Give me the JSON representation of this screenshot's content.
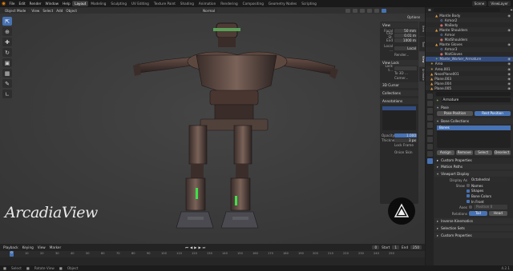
{
  "topbar": {
    "menus": [
      "File",
      "Edit",
      "Render",
      "Window",
      "Help"
    ],
    "workspaces": [
      "Layout",
      "Modeling",
      "Sculpting",
      "UV Editing",
      "Texture Paint",
      "Shading",
      "Animation",
      "Rendering",
      "Compositing",
      "Geometry Nodes",
      "Scripting"
    ],
    "active_workspace": "Layout",
    "scene": "Scene",
    "view_layer": "ViewLayer"
  },
  "viewport": {
    "mode": "Object Mode",
    "menus": [
      "View",
      "Select",
      "Add",
      "Object"
    ],
    "transform": "Normal",
    "options": "Options",
    "watermark": "ArcadiaView"
  },
  "npanel": {
    "view_title": "View",
    "rows": [
      {
        "k": "Focal",
        "v": "50 mm"
      },
      {
        "k": "Clip St.",
        "v": "0.01 m"
      },
      {
        "k": "End",
        "v": "1000 m"
      }
    ],
    "local": "Local ...",
    "local_val": "Local",
    "render": "Render...",
    "view_lock": "View Lock",
    "lock_to": "Lock t...",
    "to_3d": "To 3D ...",
    "camera": "Camer...",
    "cursor3d": "3D Cursor",
    "collections": "Collections",
    "annotations": "Annotations",
    "opacity_label": "Opacity",
    "opacity": "1.000",
    "thickness_label": "Thickness",
    "thickness": "3 px",
    "lock_frame": "Lock Frame",
    "onion": "Onion Skin",
    "tabs": [
      "Item",
      "Tool",
      "View",
      "Animate"
    ]
  },
  "outliner": {
    "rows": [
      {
        "name": "Mantle Body",
        "icon": "mesh",
        "depth": 2,
        "sel": false
      },
      {
        "name": "Armor2",
        "icon": "mod",
        "depth": 3,
        "sel": false
      },
      {
        "name": "MaBody",
        "icon": "mat",
        "depth": 3,
        "sel": false
      },
      {
        "name": "Mante Shoulders",
        "icon": "mesh",
        "depth": 2,
        "sel": false
      },
      {
        "name": "Armor",
        "icon": "mod",
        "depth": 3,
        "sel": false
      },
      {
        "name": "MatShoulders",
        "icon": "mat",
        "depth": 3,
        "sel": false
      },
      {
        "name": "Mante Gloves",
        "icon": "mesh",
        "depth": 2,
        "sel": false
      },
      {
        "name": "Armor3",
        "icon": "mod",
        "depth": 3,
        "sel": false
      },
      {
        "name": "MatGloves",
        "icon": "mat",
        "depth": 3,
        "sel": false
      },
      {
        "name": "Mante_Worker_Armature",
        "icon": "arm",
        "depth": 2,
        "sel": true
      },
      {
        "name": "Area",
        "icon": "light",
        "depth": 1,
        "sel": false
      },
      {
        "name": "Area.001",
        "icon": "light",
        "depth": 1,
        "sel": false
      },
      {
        "name": "NeonPlane001",
        "icon": "mesh",
        "depth": 1,
        "sel": false
      },
      {
        "name": "Plane.003",
        "icon": "mesh",
        "depth": 1,
        "sel": false
      },
      {
        "name": "Plane.004",
        "icon": "mesh",
        "depth": 1,
        "sel": false
      },
      {
        "name": "Plane.005",
        "icon": "mesh",
        "depth": 1,
        "sel": false
      }
    ]
  },
  "properties": {
    "object_name": "Armature",
    "pose_section": "Pose",
    "pose_position": "Pose Position",
    "rest_position": "Rest Position",
    "bone_collections": "Bone Collections",
    "collection_item": "Bones",
    "assign": "Assign",
    "remove": "Remove",
    "select": "Select",
    "deselect": "Deselect",
    "custom_props": "Custom Properties",
    "motion_paths": "Motion Paths",
    "viewport_display": "Viewport Display",
    "display_as_label": "Display As",
    "display_as": "Octahedral",
    "show_label": "Show",
    "show_items": [
      {
        "label": "Names",
        "on": false
      },
      {
        "label": "Shapes",
        "on": true
      },
      {
        "label": "Bone Colors",
        "on": true
      },
      {
        "label": "In Front",
        "on": true
      }
    ],
    "axes_label": "Axes",
    "position_label": "Position",
    "position": "0",
    "relations_label": "Relations",
    "tail": "Tail",
    "head": "Head",
    "inverse_kin": "Inverse Kinematics",
    "selection_sets": "Selection Sets",
    "custom_props2": "Custom Properties"
  },
  "timeline": {
    "menus": [
      "Playback",
      "Keying",
      "View",
      "Marker"
    ],
    "current": "0",
    "start_label": "Start",
    "start": "1",
    "end_label": "End",
    "end": "250",
    "ticks": [
      "0",
      "10",
      "20",
      "30",
      "40",
      "50",
      "60",
      "70",
      "80",
      "90",
      "100",
      "110",
      "120",
      "130",
      "140",
      "150",
      "160",
      "170",
      "180",
      "190",
      "200",
      "210",
      "220",
      "230",
      "240",
      "250"
    ]
  },
  "status": {
    "items": [
      "Select",
      "Rotate View",
      "Object"
    ],
    "version": "4.2.1"
  }
}
